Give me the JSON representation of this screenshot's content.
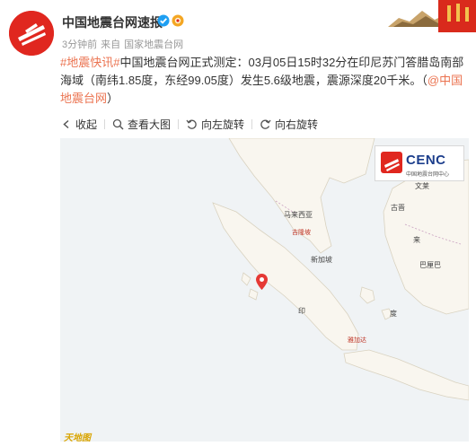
{
  "post": {
    "author": "中国地震台网速报",
    "time": "3分钟前",
    "source_prefix": "来自",
    "source": "国家地震台网"
  },
  "content": {
    "tag": "#地震快讯#",
    "text": "中国地震台网正式测定：03月05日15时32分在印尼苏门答腊岛南部海域（南纬1.85度，东经99.05度）发生5.6级地震，震源深度20千米。（",
    "mention": "@中国地震台网",
    "tail": "）"
  },
  "toolbar": {
    "collapse": "收起",
    "view_large": "查看大图",
    "rotate_left": "向左旋转",
    "rotate_right": "向右旋转"
  },
  "map": {
    "logo_text": "CENC",
    "logo_sub": "中国地震台网中心",
    "watermark": "天地图",
    "labels": {
      "malaysia": "马来西亚",
      "kuala_lumpur": "吉隆坡",
      "singapore": "新加坡",
      "indonesia_yin": "印",
      "indonesia_du": "度",
      "jakarta": "雅加达",
      "lai": "来",
      "kuching": "古晋",
      "brunei": "文莱",
      "balikpapan": "巴厘巴"
    }
  },
  "colors": {
    "tag": "#eb7350",
    "brand_red": "#e0271f",
    "map_sea": "#f0f3f5",
    "map_land": "#f9f6ef",
    "pin": "#e53935"
  }
}
